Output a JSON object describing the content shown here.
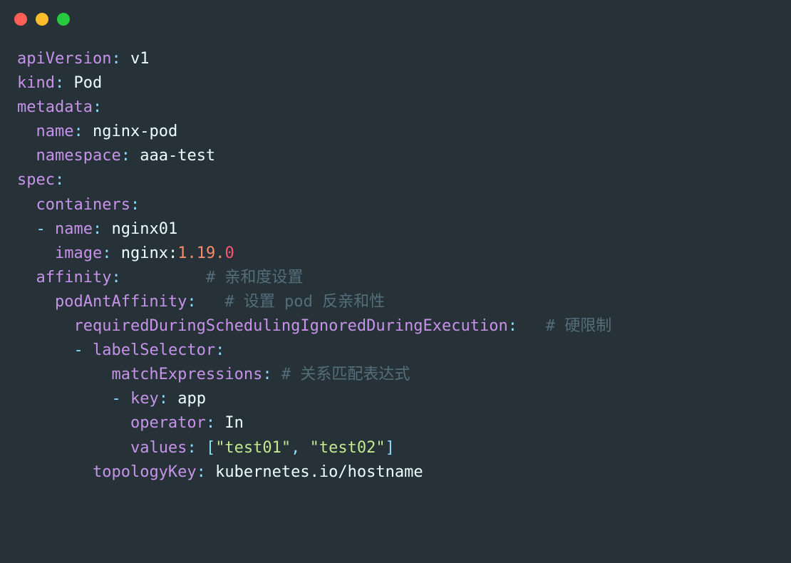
{
  "yaml": {
    "apiVersion_key": "apiVersion",
    "apiVersion_val": "v1",
    "kind_key": "kind",
    "kind_val": "Pod",
    "metadata_key": "metadata",
    "name_key": "name",
    "name_val": "nginx-pod",
    "namespace_key": "namespace",
    "namespace_val": "aaa-test",
    "spec_key": "spec",
    "containers_key": "containers",
    "container_name_key": "name",
    "container_name_val": "nginx01",
    "image_key": "image",
    "image_val_prefix": "nginx:",
    "image_val_num1": "1.19.",
    "image_val_num2": "0",
    "affinity_key": "affinity",
    "affinity_comment": "# 亲和度设置",
    "podAntiAffinity_key": "podAntAffinity",
    "podAntiAffinity_comment": "# 设置 pod 反亲和性",
    "required_key": "requiredDuringSchedulingIgnoredDuringExecution",
    "required_comment": "# 硬限制",
    "labelSelector_key": "labelSelector",
    "matchExpressions_key": "matchExpressions",
    "matchExpressions_comment": "# 关系匹配表达式",
    "expr_key_key": "key",
    "expr_key_val": "app",
    "operator_key": "operator",
    "operator_val": "In",
    "values_key": "values",
    "values_v1": "\"test01\"",
    "values_v2": "\"test02\"",
    "topologyKey_key": "topologyKey",
    "topologyKey_val": "kubernetes.io/hostname"
  },
  "punct": {
    "colon": ":",
    "dash": "-",
    "lbracket": "[",
    "rbracket": "]",
    "comma": ","
  }
}
